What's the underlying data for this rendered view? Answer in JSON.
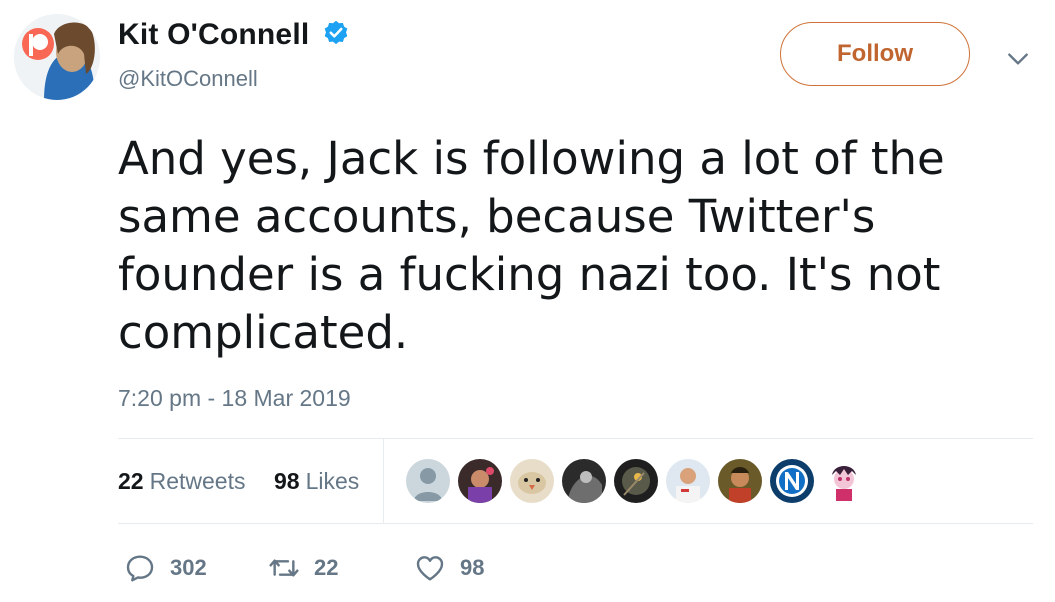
{
  "user": {
    "display_name": "Kit O'Connell",
    "handle": "@KitOConnell",
    "verified": true,
    "avatar_icon": "user-avatar-photo"
  },
  "header": {
    "follow_label": "Follow",
    "menu_icon": "chevron-down-icon"
  },
  "tweet": {
    "text": "And yes, Jack is following a lot of the same accounts, because Twitter's founder is a fucking nazi too. It's not complicated.",
    "timestamp": "7:20 pm - 18 Mar 2019"
  },
  "stats": {
    "retweets_count": "22",
    "retweets_label": "Retweets",
    "likes_count": "98",
    "likes_label": "Likes"
  },
  "likers": [
    "default-egg-avatar",
    "avatar-2",
    "avatar-3",
    "avatar-4",
    "avatar-5",
    "avatar-6",
    "avatar-7",
    "napoli-logo-avatar",
    "avatar-9"
  ],
  "actions": {
    "reply_count": "302",
    "retweet_count": "22",
    "like_count": "98"
  },
  "colors": {
    "follow_accent": "#d0733a",
    "verified_blue": "#1da1f2",
    "secondary_text": "#657786",
    "divider": "#e6ecf0"
  }
}
